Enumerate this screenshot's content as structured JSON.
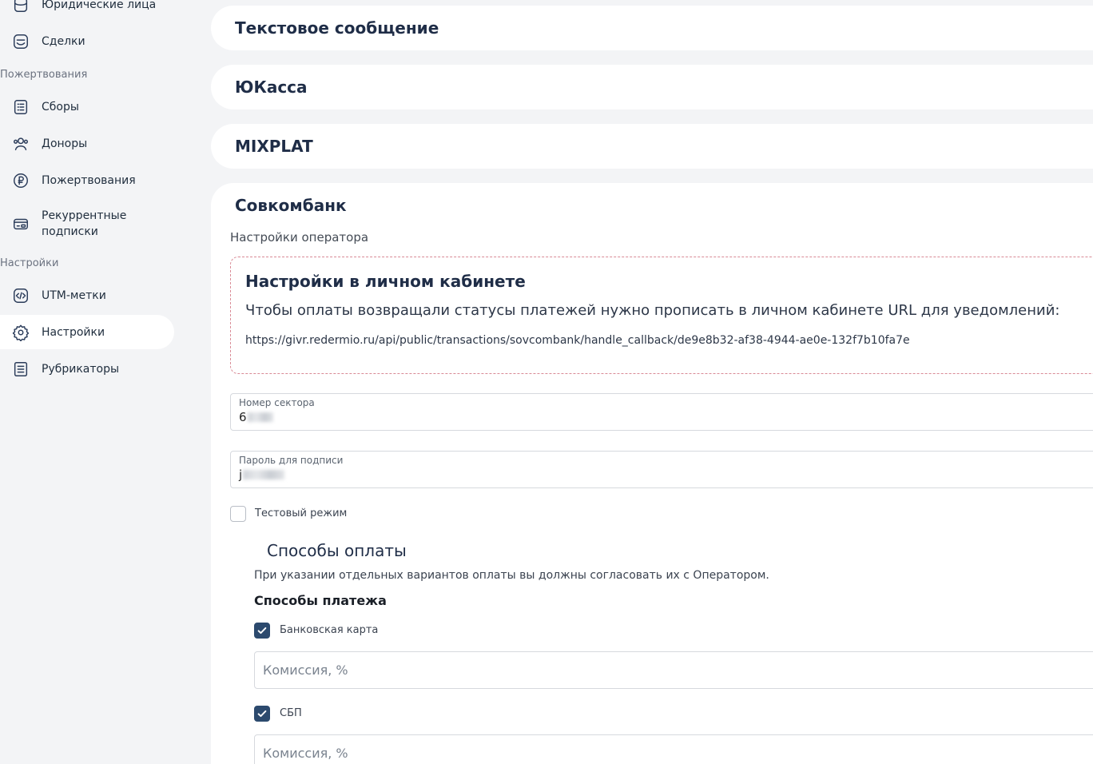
{
  "sidebar": {
    "items_top": [
      {
        "label": "Юридические лица",
        "icon": "building-icon"
      },
      {
        "label": "Сделки",
        "icon": "deals-icon"
      }
    ],
    "section_donations": "Пожертвования",
    "items_donations": [
      {
        "label": "Сборы",
        "icon": "list-icon"
      },
      {
        "label": "Доноры",
        "icon": "users-icon"
      },
      {
        "label": "Пожертвования",
        "icon": "ruble-icon"
      },
      {
        "label_line1": "Рекуррентные",
        "label_line2": "подписки",
        "icon": "card-icon"
      }
    ],
    "section_settings": "Настройки",
    "items_settings": [
      {
        "label": "UTM-метки",
        "icon": "code-icon"
      },
      {
        "label": "Настройки",
        "icon": "gear-icon",
        "active": true
      },
      {
        "label": "Рубрикаторы",
        "icon": "rubric-icon"
      }
    ]
  },
  "panels": {
    "sms": "Текстовое сообщение",
    "yookassa": "ЮКасса",
    "mixplat": "MIXPLAT",
    "sovcombank": "Совкомбанк"
  },
  "sovcombank": {
    "operator_settings": "Настройки оператора",
    "info_title": "Настройки в личном кабинете",
    "info_text": "Чтобы оплаты возвращали статусы платежей нужно прописать в личном кабинете URL для уведомлений:",
    "info_url": "https://givr.redermio.ru/api/public/transactions/sovcombank/handle_callback/de9e8b32-af38-4944-ae0e-132f7b10fa7e",
    "sector_label": "Номер сектора",
    "sector_value_visible": "6",
    "password_label": "Пароль для подписи",
    "password_value_visible": "j",
    "test_mode_label": "Тестовый режим",
    "test_mode_checked": false,
    "payment_methods_title": "Способы оплаты",
    "payment_methods_note": "При указании отдельных вариантов оплаты вы должны согласовать их с Оператором.",
    "payment_types_title": "Способы платежа",
    "bank_card_label": "Банковская карта",
    "bank_card_checked": true,
    "sbp_label": "СБП",
    "sbp_checked": true,
    "commission_placeholder": "Комиссия, %"
  },
  "colors": {
    "background": "#f3f4f6",
    "panel": "#ffffff",
    "accent": "#2c4a6e",
    "dashed_border": "#d98a95"
  }
}
